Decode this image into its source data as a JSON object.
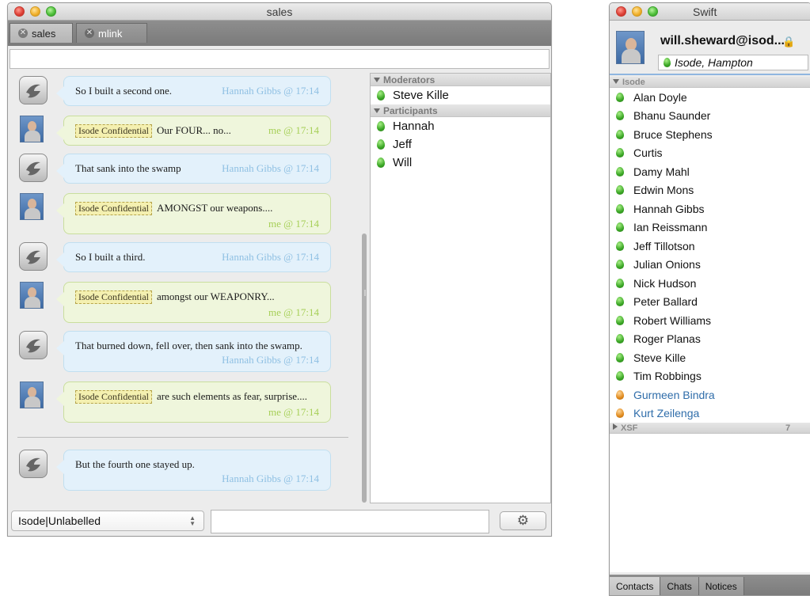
{
  "chat_window": {
    "title": "sales",
    "tabs": [
      {
        "label": "sales",
        "active": true
      },
      {
        "label": "mlink",
        "active": false
      }
    ],
    "messages": [
      {
        "from": "them",
        "label": "",
        "text": "So I built a second one.",
        "meta": "Hannah Gibbs @ 17:14"
      },
      {
        "from": "me",
        "label": "Isode Confidential",
        "text": "Our FOUR... no...",
        "meta": "me @ 17:14"
      },
      {
        "from": "them",
        "label": "",
        "text": "That sank into the swamp",
        "meta": "Hannah Gibbs @ 17:14"
      },
      {
        "from": "me",
        "label": "Isode Confidential",
        "text": "AMONGST our weapons....",
        "meta": "me @ 17:14"
      },
      {
        "from": "them",
        "label": "",
        "text": "So I built a third.",
        "meta": "Hannah Gibbs @ 17:14"
      },
      {
        "from": "me",
        "label": "Isode Confidential",
        "text": "amongst our WEAPONRY...",
        "meta": "me @ 17:14"
      },
      {
        "from": "them",
        "label": "",
        "text": "That burned down, fell over, then sank into the swamp.",
        "meta": "Hannah Gibbs @ 17:14"
      },
      {
        "from": "me",
        "label": "Isode Confidential",
        "text": "are such elements as fear, surprise....",
        "meta": "me @ 17:14"
      },
      {
        "from": "them",
        "label": "",
        "text": "But the fourth one stayed up.",
        "meta": "Hannah Gibbs @ 17:14"
      }
    ],
    "occupants": {
      "moderators_header": "Moderators",
      "moderators": [
        "Steve Kille"
      ],
      "participants_header": "Participants",
      "participants": [
        "Hannah",
        "Jeff",
        "Will"
      ]
    },
    "security_label_select": "Isode|Unlabelled",
    "settings_icon": "gear-icon"
  },
  "roster_window": {
    "title": "Swift",
    "account": "will.sheward@isod...",
    "status": "Isode, Hampton",
    "groups": [
      {
        "name": "Isode",
        "expanded": true,
        "count": "",
        "contacts": [
          {
            "name": "Alan Doyle",
            "presence": "available"
          },
          {
            "name": "Bhanu Saunder",
            "presence": "available"
          },
          {
            "name": "Bruce Stephens",
            "presence": "available"
          },
          {
            "name": "Curtis",
            "presence": "available"
          },
          {
            "name": "Damy Mahl",
            "presence": "available"
          },
          {
            "name": "Edwin Mons",
            "presence": "available"
          },
          {
            "name": "Hannah Gibbs",
            "presence": "available"
          },
          {
            "name": "Ian Reissmann",
            "presence": "available"
          },
          {
            "name": "Jeff Tillotson",
            "presence": "available"
          },
          {
            "name": "Julian Onions",
            "presence": "available"
          },
          {
            "name": "Nick Hudson",
            "presence": "available"
          },
          {
            "name": "Peter Ballard",
            "presence": "available"
          },
          {
            "name": "Robert Williams",
            "presence": "available"
          },
          {
            "name": "Roger Planas",
            "presence": "available"
          },
          {
            "name": "Steve Kille",
            "presence": "available"
          },
          {
            "name": "Tim Robbings",
            "presence": "available"
          },
          {
            "name": "Gurmeen Bindra",
            "presence": "away"
          },
          {
            "name": "Kurt Zeilenga",
            "presence": "away"
          }
        ]
      },
      {
        "name": "XSF",
        "expanded": false,
        "count": "7",
        "contacts": []
      }
    ],
    "tabs": [
      {
        "label": "Contacts",
        "active": true
      },
      {
        "label": "Chats",
        "active": false
      },
      {
        "label": "Notices",
        "active": false
      }
    ]
  },
  "colors": {
    "available": "#3aa625",
    "away": "#e08a1e",
    "away_text": "#2f6daa",
    "their_bubble": "#e3f1fb",
    "my_bubble": "#eff6dc",
    "their_meta": "#8fc0e3",
    "my_meta": "#a6cf57"
  }
}
